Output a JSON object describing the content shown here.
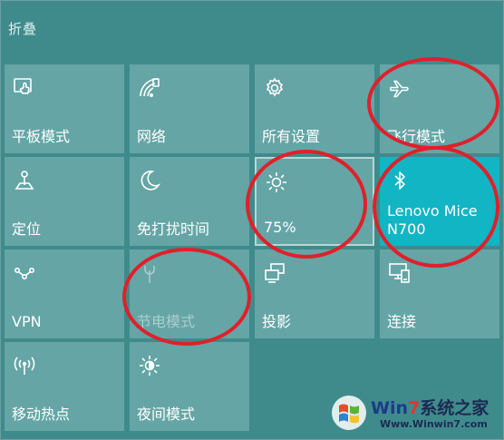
{
  "header": {
    "collapse_label": "折叠"
  },
  "tiles": [
    {
      "id": "tablet-mode",
      "label": "平板模式",
      "icon": "tablet-mode-icon",
      "state": "off"
    },
    {
      "id": "network",
      "label": "网络",
      "icon": "network-icon",
      "state": "off"
    },
    {
      "id": "all-settings",
      "label": "所有设置",
      "icon": "gear-icon",
      "state": "off"
    },
    {
      "id": "airplane-mode",
      "label": "飞行模式",
      "icon": "airplane-icon",
      "state": "off"
    },
    {
      "id": "location",
      "label": "定位",
      "icon": "location-icon",
      "state": "off"
    },
    {
      "id": "quiet-hours",
      "label": "免打扰时间",
      "icon": "moon-icon",
      "state": "off"
    },
    {
      "id": "brightness",
      "label": "75%",
      "icon": "brightness-icon",
      "state": "focused"
    },
    {
      "id": "bluetooth",
      "label": "Lenovo Mice N700",
      "icon": "bluetooth-icon",
      "state": "on"
    },
    {
      "id": "vpn",
      "label": "VPN",
      "icon": "vpn-icon",
      "state": "off"
    },
    {
      "id": "battery-saver",
      "label": "节电模式",
      "icon": "battery-saver-icon",
      "state": "disabled"
    },
    {
      "id": "project",
      "label": "投影",
      "icon": "project-icon",
      "state": "off"
    },
    {
      "id": "connect",
      "label": "连接",
      "icon": "connect-icon",
      "state": "off"
    },
    {
      "id": "mobile-hotspot",
      "label": "移动热点",
      "icon": "hotspot-icon",
      "state": "off"
    },
    {
      "id": "night-light",
      "label": "夜间模式",
      "icon": "night-light-icon",
      "state": "off"
    }
  ],
  "colors": {
    "background": "#3f8b8c",
    "tile": "#65a5a6",
    "tile_active": "#11b5c4",
    "annotation": "#e0202a"
  },
  "watermark": {
    "brand_prefix": "Win",
    "brand_seven": "7",
    "brand_suffix": "系统之家",
    "url": "Www.Winwin7.com"
  }
}
